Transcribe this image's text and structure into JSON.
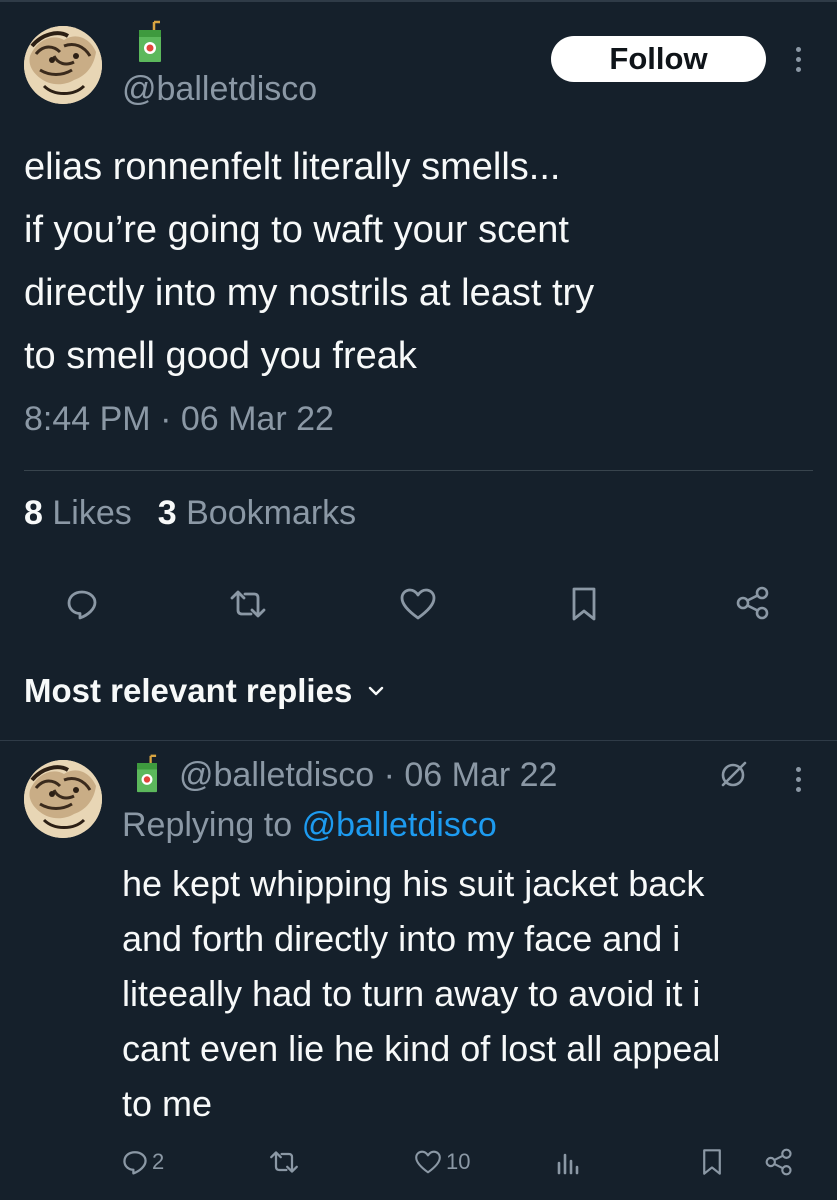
{
  "tweet": {
    "handle": "@balletdisco",
    "follow_label": "Follow",
    "text_lines": [
      "elias ronnenfelt literally smells...",
      "if you’re going to waft your scent",
      "directly into my nostrils at least try",
      "to smell good you freak"
    ],
    "timestamp": "8:44 PM · 06 Mar 22",
    "likes_count": "8",
    "likes_label": "Likes",
    "bookmarks_count": "3",
    "bookmarks_label": "Bookmarks",
    "actions": [
      "reply",
      "retweet",
      "like",
      "bookmark",
      "share"
    ]
  },
  "replies_section": {
    "heading": "Most relevant replies"
  },
  "reply": {
    "handle": "@balletdisco",
    "date": "06 Mar 22",
    "meta": "@balletdisco · 06 Mar 22",
    "replying_to_label": "Replying to",
    "replying_to_handle": "@balletdisco",
    "text_lines": [
      "he kept whipping his suit jacket back",
      "and forth directly into  my face and i",
      "liteeally had to turn away to avoid it i",
      "cant even lie he kind of lost all appeal",
      "to me"
    ],
    "reply_count": "2",
    "like_count": "10"
  },
  "colors": {
    "background": "#15202b",
    "text_primary": "#f7f9f9",
    "text_secondary": "#8b98a5",
    "divider": "#38444d",
    "link": "#1d9bf0",
    "follow_bg": "#ffffff"
  }
}
